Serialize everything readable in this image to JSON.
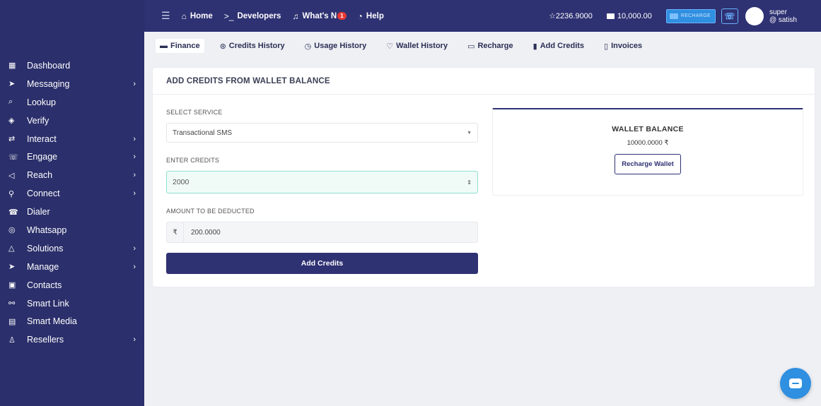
{
  "sidebar": {
    "items": [
      {
        "label": "Dashboard",
        "icon": "dashboard-icon",
        "glyph": "▦",
        "arrow": false
      },
      {
        "label": "Messaging",
        "icon": "send-icon",
        "glyph": "➤",
        "arrow": true
      },
      {
        "label": "Lookup",
        "icon": "search-icon",
        "glyph": "⌕",
        "arrow": false
      },
      {
        "label": "Verify",
        "icon": "verify-icon",
        "glyph": "◈",
        "arrow": false
      },
      {
        "label": "Interact",
        "icon": "interact-icon",
        "glyph": "⇄",
        "arrow": true
      },
      {
        "label": "Engage",
        "icon": "engage-icon",
        "glyph": "☏",
        "arrow": true
      },
      {
        "label": "Reach",
        "icon": "megaphone-icon",
        "glyph": "◁",
        "arrow": true
      },
      {
        "label": "Connect",
        "icon": "connect-icon",
        "glyph": "⚲",
        "arrow": true
      },
      {
        "label": "Dialer",
        "icon": "phone-icon",
        "glyph": "☎",
        "arrow": false
      },
      {
        "label": "Whatsapp",
        "icon": "whatsapp-icon",
        "glyph": "◎",
        "arrow": false
      },
      {
        "label": "Solutions",
        "icon": "triangle-icon",
        "glyph": "△",
        "arrow": true
      },
      {
        "label": "Manage",
        "icon": "send-icon",
        "glyph": "➤",
        "arrow": true
      },
      {
        "label": "Contacts",
        "icon": "contacts-icon",
        "glyph": "▣",
        "arrow": false
      },
      {
        "label": "Smart Link",
        "icon": "link-icon",
        "glyph": "⚯",
        "arrow": false
      },
      {
        "label": "Smart Media",
        "icon": "media-icon",
        "glyph": "▤",
        "arrow": false
      },
      {
        "label": "Resellers",
        "icon": "resellers-icon",
        "glyph": "♙",
        "arrow": true
      }
    ]
  },
  "topbar": {
    "home": "Home",
    "developers": "Developers",
    "whats_new": "What's N",
    "whats_new_badge": "1",
    "help": "Help",
    "credits": "☆2236.9000",
    "wallet": "10,000.00",
    "recharge": "RECHARGE",
    "user_name": "super",
    "user_handle": "@ satish"
  },
  "subnav": {
    "tabs": [
      {
        "label": "Finance",
        "glyph": "▬",
        "icon": "finance-icon"
      },
      {
        "label": "Credits History",
        "glyph": "⊛",
        "icon": "credits-history-icon"
      },
      {
        "label": "Usage History",
        "glyph": "◷",
        "icon": "clock-icon"
      },
      {
        "label": "Wallet History",
        "glyph": "♡",
        "icon": "wallet-history-icon"
      },
      {
        "label": "Recharge",
        "glyph": "▭",
        "icon": "recharge-icon"
      },
      {
        "label": "Add Credits",
        "glyph": "▮",
        "icon": "add-credits-icon"
      },
      {
        "label": "Invoices",
        "glyph": "▯",
        "icon": "invoice-icon"
      }
    ]
  },
  "card": {
    "title": "ADD CREDITS FROM WALLET BALANCE",
    "select_service_label": "SELECT SERVICE",
    "select_service_value": "Transactional SMS",
    "enter_credits_label": "ENTER CREDITS",
    "enter_credits_value": "2000",
    "amount_label": "AMOUNT TO BE DEDUCTED",
    "amount_currency": "₹",
    "amount_value": "200.0000",
    "add_button": "Add Credits"
  },
  "wallet": {
    "title": "WALLET BALANCE",
    "amount": "10000.0000 ₹",
    "button": "Recharge Wallet"
  },
  "colors": {
    "sidebar": "#2b2f6b",
    "topbar": "#2e3172",
    "accent": "#2f8fe0"
  }
}
